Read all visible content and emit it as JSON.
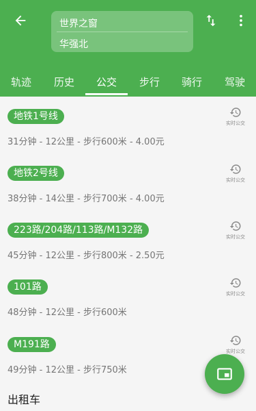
{
  "header": {
    "origin": "世界之窗",
    "destination": "华强北",
    "tabs": [
      {
        "label": "轨迹"
      },
      {
        "label": "历史"
      },
      {
        "label": "公交"
      },
      {
        "label": "步行"
      },
      {
        "label": "骑行"
      },
      {
        "label": "驾驶"
      }
    ],
    "active_tab": "公交"
  },
  "routes": [
    {
      "name": "地铁1号线",
      "summary": "31分钟 - 12公里 - 步行600米 - 4.00元",
      "realtime_label": "实时公交"
    },
    {
      "name": "地铁2号线",
      "summary": "38分钟 - 14公里 - 步行700米 - 4.00元",
      "realtime_label": "实时公交"
    },
    {
      "name": "223路/204路/113路/M132路",
      "summary": "45分钟 - 12公里 - 步行800米 - 2.50元",
      "realtime_label": "实时公交"
    },
    {
      "name": "101路",
      "summary": "48分钟 - 12公里 - 步行600米",
      "realtime_label": "实时公交"
    },
    {
      "name": "M191路",
      "summary": "49分钟 - 12公里 - 步行750米",
      "realtime_label": "实时公交"
    }
  ],
  "taxi_section": {
    "title": "出租车"
  },
  "icons": {
    "back": "arrow-left-icon",
    "swap": "swap-vertical-icon",
    "more": "more-vert-icon",
    "realtime": "history-icon",
    "fab": "picture-in-picture-icon"
  },
  "colors": {
    "primary": "#4caf50",
    "background": "#f5f5f5",
    "secondary_text": "#757575"
  }
}
